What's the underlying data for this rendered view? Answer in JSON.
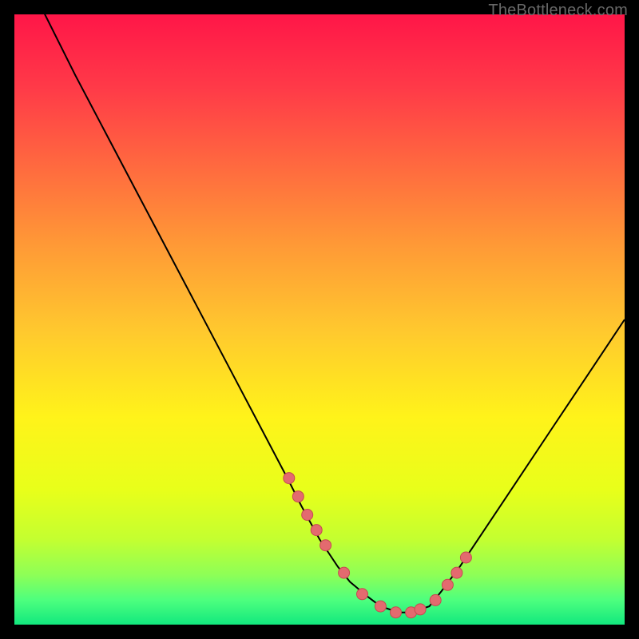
{
  "attribution": "TheBottleneck.com",
  "colors": {
    "bg": "#000000",
    "curve": "#000000",
    "dot_fill": "#e36a6f",
    "dot_stroke": "#c64a50",
    "grad_stops": [
      {
        "offset": 0.0,
        "color": "#ff1648"
      },
      {
        "offset": 0.12,
        "color": "#ff3a48"
      },
      {
        "offset": 0.25,
        "color": "#ff6a3f"
      },
      {
        "offset": 0.38,
        "color": "#ff9a36"
      },
      {
        "offset": 0.52,
        "color": "#ffc92e"
      },
      {
        "offset": 0.66,
        "color": "#fff31a"
      },
      {
        "offset": 0.78,
        "color": "#e8ff1a"
      },
      {
        "offset": 0.86,
        "color": "#c4ff30"
      },
      {
        "offset": 0.92,
        "color": "#8cff58"
      },
      {
        "offset": 0.96,
        "color": "#4dff7e"
      },
      {
        "offset": 1.0,
        "color": "#12e87e"
      }
    ]
  },
  "chart_data": {
    "type": "line",
    "title": "",
    "xlabel": "",
    "ylabel": "",
    "xlim": [
      0,
      100
    ],
    "ylim": [
      0,
      100
    ],
    "series": [
      {
        "name": "curve",
        "x": [
          0,
          5,
          10,
          15,
          20,
          25,
          30,
          35,
          40,
          45,
          47,
          50,
          53,
          55,
          58,
          60,
          63,
          65,
          68,
          70,
          73,
          77,
          82,
          88,
          94,
          100
        ],
        "y": [
          110,
          100,
          90,
          80.5,
          71,
          61.5,
          52,
          42.5,
          33,
          23.5,
          19.5,
          14,
          9.5,
          7,
          4.5,
          3,
          2,
          2,
          3,
          5.5,
          9.5,
          15.5,
          23,
          32,
          41,
          50
        ]
      }
    ],
    "dots": {
      "name": "markers",
      "x": [
        45,
        46.5,
        48,
        49.5,
        51,
        54,
        57,
        60,
        62.5,
        65,
        66.5,
        69,
        71,
        72.5,
        74
      ],
      "y": [
        24,
        21,
        18,
        15.5,
        13,
        8.5,
        5,
        3,
        2,
        2,
        2.5,
        4,
        6.5,
        8.5,
        11
      ]
    }
  }
}
